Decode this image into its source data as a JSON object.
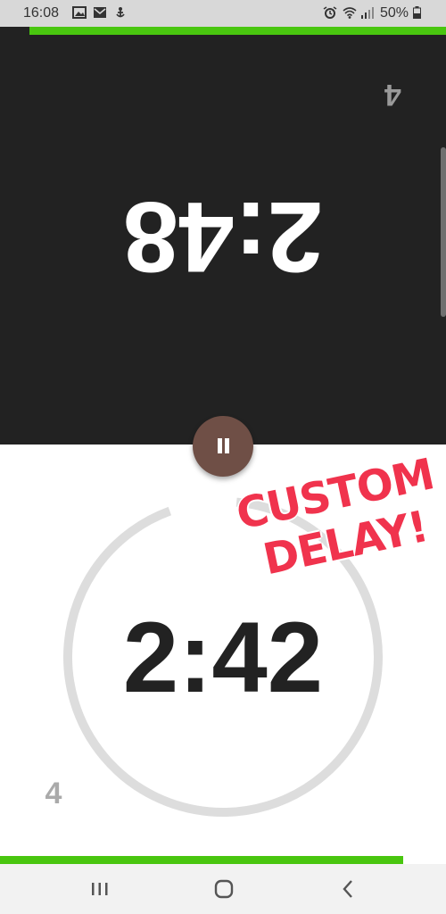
{
  "status_bar": {
    "time": "16:08",
    "battery_percent": "50%",
    "icons": [
      "gallery-icon",
      "mail-icon",
      "notification-icon",
      "alarm-icon",
      "wifi-icon",
      "signal-icon",
      "battery-icon"
    ]
  },
  "top_player": {
    "time": "2:48",
    "moves": "4",
    "progress_fraction": 0.934,
    "orientation": "upside-down"
  },
  "bottom_player": {
    "time": "2:42",
    "moves": "4",
    "progress_fraction": 0.904,
    "delay_ring_fraction": 0.93
  },
  "pause_button": {
    "icon": "pause-icon"
  },
  "promo": {
    "line1": "CUSTOM",
    "line2": "DELAY!"
  },
  "nav_bar": {
    "icons": [
      "recent-apps-icon",
      "home-icon",
      "back-icon"
    ]
  },
  "colors": {
    "top_background": "#222222",
    "progress_green": "#49c60f",
    "pause_button": "#6f4f46",
    "promo_red": "#f0334d",
    "ring_gray": "#dddddd"
  }
}
